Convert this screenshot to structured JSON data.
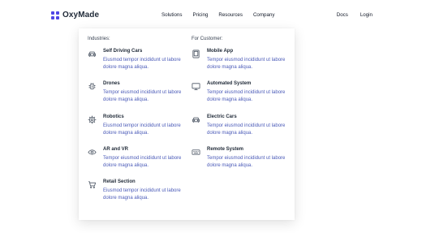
{
  "brand": {
    "name": "OxyMade",
    "color": "#4f46e5"
  },
  "nav": {
    "links": [
      "Solutions",
      "Pricing",
      "Resources",
      "Company"
    ],
    "right": [
      "Docs",
      "Login"
    ]
  },
  "menu": {
    "industries": {
      "title": "Industries:",
      "items": [
        {
          "title": "Self Driving Cars",
          "desc": "Eiusmod tempor incididunt ut labore dolore magna aliqua.",
          "icon": "car-icon"
        },
        {
          "title": "Drones",
          "desc": "Tempor eiusmod incididunt ut labore dolore magna aliqua.",
          "icon": "drone-icon"
        },
        {
          "title": "Robotics",
          "desc": "Eiusmod tempor incididunt ut labore dolore magna aliqua.",
          "icon": "gear-icon"
        },
        {
          "title": "AR and VR",
          "desc": "Tempor eiusmod incididunt ut labore dolore magna aliqua.",
          "icon": "eye-icon"
        },
        {
          "title": "Retail Section",
          "desc": "Eiusmod tempor incididunt ut labore dolore magna aliqua.",
          "icon": "cart-icon"
        }
      ]
    },
    "customer": {
      "title": "For Customer:",
      "items": [
        {
          "title": "Mobile App",
          "desc": "Tempor eiusmod incididunt ut labore dolore magna aliqua.",
          "icon": "mobile-icon"
        },
        {
          "title": "Automated System",
          "desc": "Tempor eiusmod incididunt ut labore dolore magna aliqua.",
          "icon": "monitor-icon"
        },
        {
          "title": "Electric Cars",
          "desc": "Tempor eiusmod incididunt ut labore dolore magna aliqua.",
          "icon": "car-icon"
        },
        {
          "title": "Remote System",
          "desc": "Tempor eiusmod incididunt ut labore dolore magna aliqua.",
          "icon": "keyboard-icon"
        }
      ]
    }
  }
}
